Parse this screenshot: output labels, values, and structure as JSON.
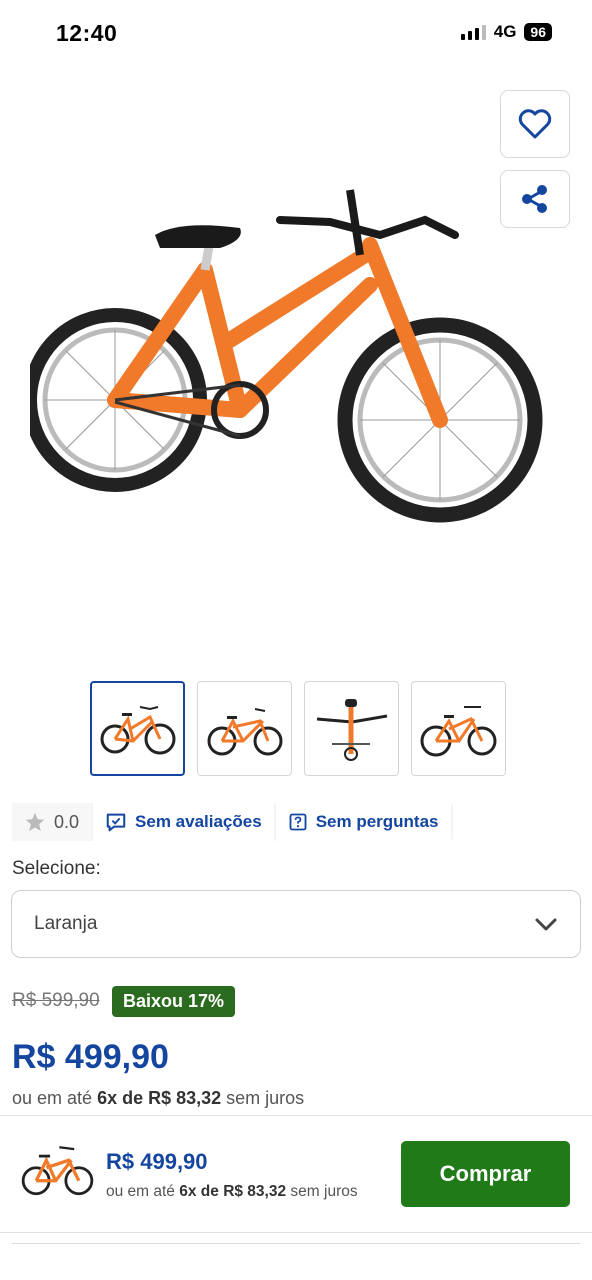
{
  "status": {
    "time": "12:40",
    "network": "4G",
    "battery": "96"
  },
  "product": {
    "rating_value": "0.0",
    "reviews_link": "Sem avaliações",
    "questions_link": "Sem perguntas",
    "select_label": "Selecione:",
    "selected_color": "Laranja",
    "old_price": "R$ 599,90",
    "discount_badge": "Baixou 17%",
    "price": "R$ 499,90",
    "installments": {
      "prefix": "ou em até ",
      "count": "6x de R$ 83,32",
      "suffix": " sem juros"
    }
  },
  "buy_bar": {
    "price": "R$ 499,90",
    "installments": {
      "prefix": "ou em até ",
      "count": "6x de R$ 83,32",
      "suffix": " sem juros"
    },
    "button_label": "Comprar"
  },
  "icons": [
    "heart-icon",
    "share-icon",
    "star-icon",
    "review-icon",
    "question-icon",
    "chevron-down-icon"
  ],
  "colors": {
    "brand_blue": "#1446a0",
    "buy_green": "#1f7a17",
    "badge_green": "#2b6b1f",
    "bike_orange": "#f07a2a"
  }
}
